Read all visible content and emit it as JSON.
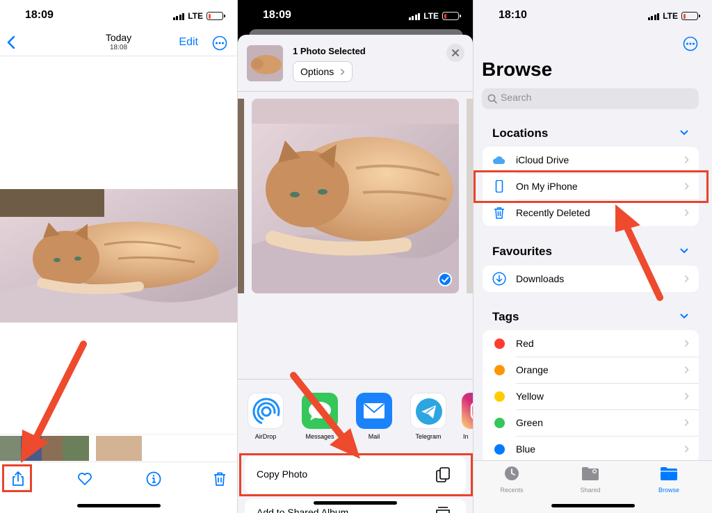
{
  "panel1": {
    "status": {
      "time": "18:09",
      "network": "LTE"
    },
    "nav": {
      "title": "Today",
      "subtitle": "18:08",
      "edit_label": "Edit"
    },
    "toolbar": {
      "icons": [
        "share-icon",
        "heart-icon",
        "info-icon",
        "trash-icon"
      ]
    }
  },
  "panel2": {
    "status": {
      "time": "18:09",
      "network": "LTE"
    },
    "header": {
      "selection_label": "1 Photo Selected",
      "options_label": "Options"
    },
    "apps": [
      {
        "label": "AirDrop",
        "icon": "airdrop-icon",
        "color": "#1c8ef9"
      },
      {
        "label": "Messages",
        "icon": "messages-icon",
        "color": "#34c759"
      },
      {
        "label": "Mail",
        "icon": "mail-icon",
        "color": "#1a82fb"
      },
      {
        "label": "Telegram",
        "icon": "telegram-icon",
        "color": "#2ca5e0"
      },
      {
        "label": "In",
        "icon": "instagram-icon",
        "color": "#c13584"
      }
    ],
    "actions": [
      {
        "label": "Copy Photo",
        "icon": "copy-icon"
      },
      {
        "label": "Add to Shared Album",
        "icon": "shared-album-icon"
      }
    ]
  },
  "panel3": {
    "status": {
      "time": "18:10",
      "network": "LTE"
    },
    "title": "Browse",
    "search": {
      "placeholder": "Search"
    },
    "locations": {
      "header": "Locations",
      "items": [
        {
          "label": "iCloud Drive",
          "icon": "icloud-icon"
        },
        {
          "label": "On My iPhone",
          "icon": "iphone-icon"
        },
        {
          "label": "Recently Deleted",
          "icon": "trash-icon"
        }
      ]
    },
    "favourites": {
      "header": "Favourites",
      "items": [
        {
          "label": "Downloads",
          "icon": "download-icon"
        }
      ]
    },
    "tags": {
      "header": "Tags",
      "items": [
        {
          "label": "Red",
          "color": "#ff3b30"
        },
        {
          "label": "Orange",
          "color": "#ff9500"
        },
        {
          "label": "Yellow",
          "color": "#ffcc00"
        },
        {
          "label": "Green",
          "color": "#34c759"
        },
        {
          "label": "Blue",
          "color": "#007aff"
        }
      ]
    },
    "tabbar": [
      {
        "label": "Recents",
        "icon": "clock-icon",
        "active": false
      },
      {
        "label": "Shared",
        "icon": "shared-folder-icon",
        "active": false
      },
      {
        "label": "Browse",
        "icon": "folder-icon",
        "active": true
      }
    ]
  },
  "colors": {
    "accent": "#007aff",
    "highlight": "#e8432b"
  }
}
